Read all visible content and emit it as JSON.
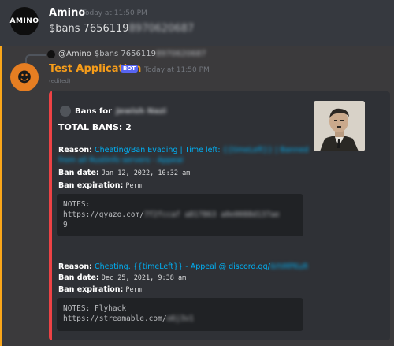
{
  "message1": {
    "username": "Amino",
    "avatar_text": "AMINO",
    "timestamp": "Today at 11:50 PM",
    "command": "$bans 7656119",
    "command_hidden": "8970620687"
  },
  "message2": {
    "reply_username": "@Amino",
    "reply_text": "$bans 7656119",
    "reply_hidden": "8970620687",
    "app_name": "Test Application",
    "bot_badge": "BOT",
    "timestamp": "Today at 11:50 PM",
    "edited": "(edited)",
    "avatar_icon": "pumpkin-icon",
    "embed": {
      "accent_color": "#ed4245",
      "author_prefix": "Bans for",
      "author_hidden": "Jewish Nazi",
      "title": "TOTAL BANS: 2",
      "bans": [
        {
          "reason_label": "Reason:",
          "reason_text": "Cheating/Ban Evading | Time left:",
          "reason_hidden_1": "{{timeLeft}} | Banned",
          "reason_hidden_2": "from all RustInfo servers - Appeal",
          "date_label": "Ban date:",
          "date_value": "Jan 12, 2022, 10:32 am",
          "expiration_label": "Ban expiration:",
          "expiration_value": "Perm",
          "notes_line1": "NOTES:",
          "notes_line2": "https://gyazo.com/",
          "notes_hidden": "7f2fccaf a817863 a0e0088d137ae",
          "notes_line3": "9"
        },
        {
          "reason_label": "Reason:",
          "reason_text": "Cheating. {{timeLeft}} - Appeal @ discord.gg/",
          "reason_hidden": "6rhMPKuR",
          "date_label": "Ban date:",
          "date_value": "Dec 25, 2021, 9:38 am",
          "expiration_label": "Ban expiration:",
          "expiration_value": "Perm",
          "notes_line1": "NOTES: Flyhack",
          "notes_line2": "https://streamable.com/",
          "notes_hidden": "o6j3v1"
        }
      ]
    }
  }
}
